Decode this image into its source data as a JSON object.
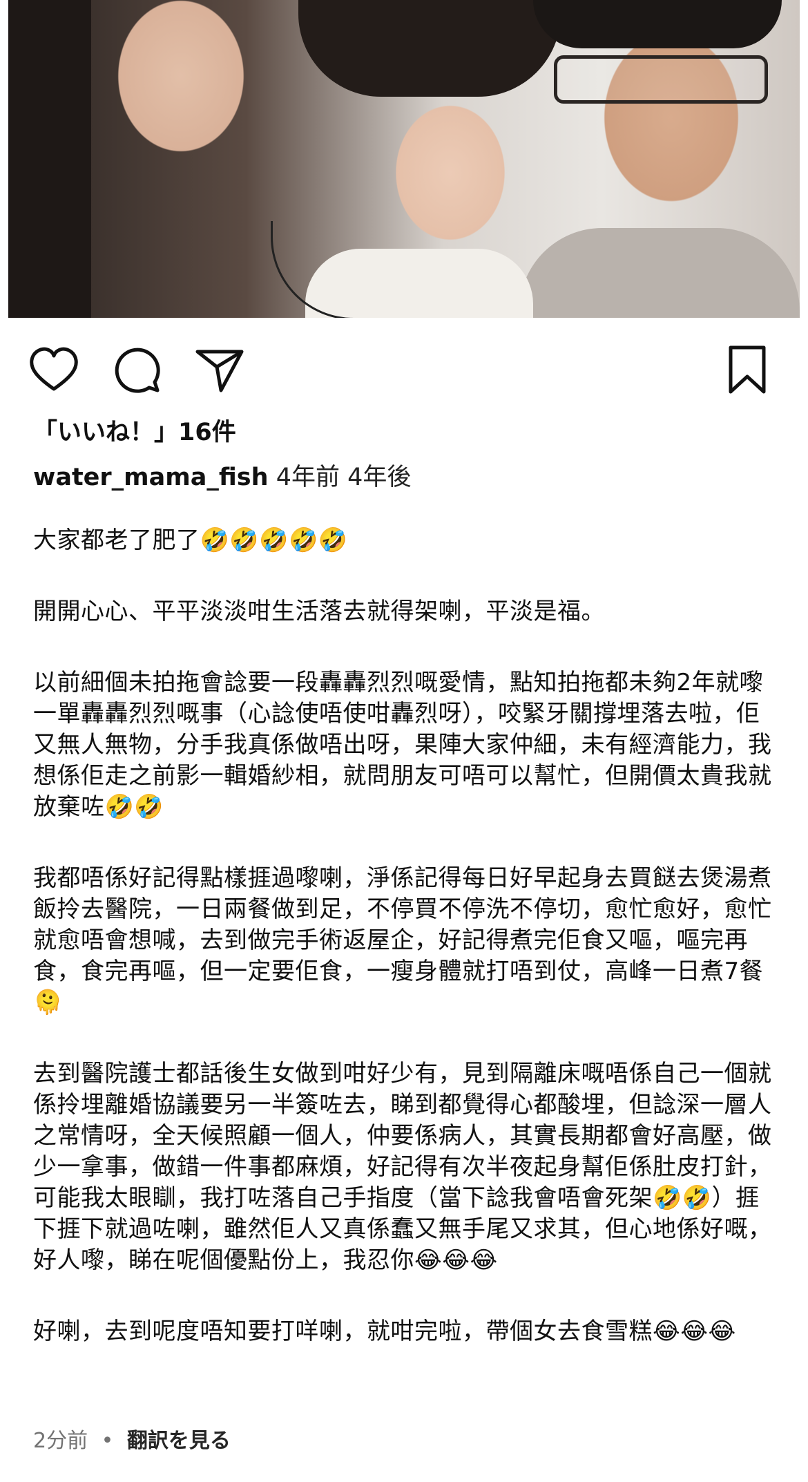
{
  "post": {
    "likes_text": "「いいね！」16件",
    "username": "water_mama_fish",
    "time_posted": "4年前",
    "time_edited": "4年後",
    "caption_paragraphs": [
      "大家都老了肥了🤣🤣🤣🤣🤣",
      "開開心心、平平淡淡咁生活落去就得架喇，平淡是福。",
      "以前細個未拍拖會諗要一段轟轟烈烈嘅愛情，點知拍拖都未夠2年就嚟一單轟轟烈烈嘅事（心諗使唔使咁轟烈呀），咬緊牙關撐埋落去啦，佢又無人無物，分手我真係做唔出呀，果陣大家仲細，未有經濟能力，我想係佢走之前影一輯婚紗相，就問朋友可唔可以幫忙，但開價太貴我就放棄咗🤣🤣",
      "我都唔係好記得點樣捱過嚟喇，淨係記得每日好早起身去買餸去煲湯煮飯拎去醫院，一日兩餐做到足，不停買不停洗不停切，愈忙愈好，愈忙就愈唔會想喊，去到做完手術返屋企，好記得煮完佢食又嘔，嘔完再食，食完再嘔，但一定要佢食，一瘦身體就打唔到仗，高峰一日煮7餐🫠",
      "去到醫院護士都話後生女做到咁好少有，見到隔離床嘅唔係自己一個就係拎埋離婚協議要另一半簽咗去，睇到都覺得心都酸埋，但諗深一層人之常情呀，全天候照顧一個人，仲要係病人，其實長期都會好高壓，做少一拿事，做錯一件事都麻煩，好記得有次半夜起身幫佢係肚皮打針，可能我太眼瞓，我打咗落自己手指度（當下諗我會唔會死架🤣🤣）捱下捱下就過咗喇，雖然佢人又真係蠢又無手尾又求其，但心地係好嘅，好人嚟，睇在呢個優點份上，我忍你😂😂😂",
      "好喇，去到呢度唔知要打咩喇，就咁完啦，帶個女去食雪糕😂😂😂"
    ],
    "footer_time": "2分前",
    "footer_separator": "•",
    "translate_label": "翻訳を見る"
  },
  "icons": {
    "like": "heart-icon",
    "comment": "comment-bubble-icon",
    "share": "paper-plane-icon",
    "save": "bookmark-icon"
  }
}
